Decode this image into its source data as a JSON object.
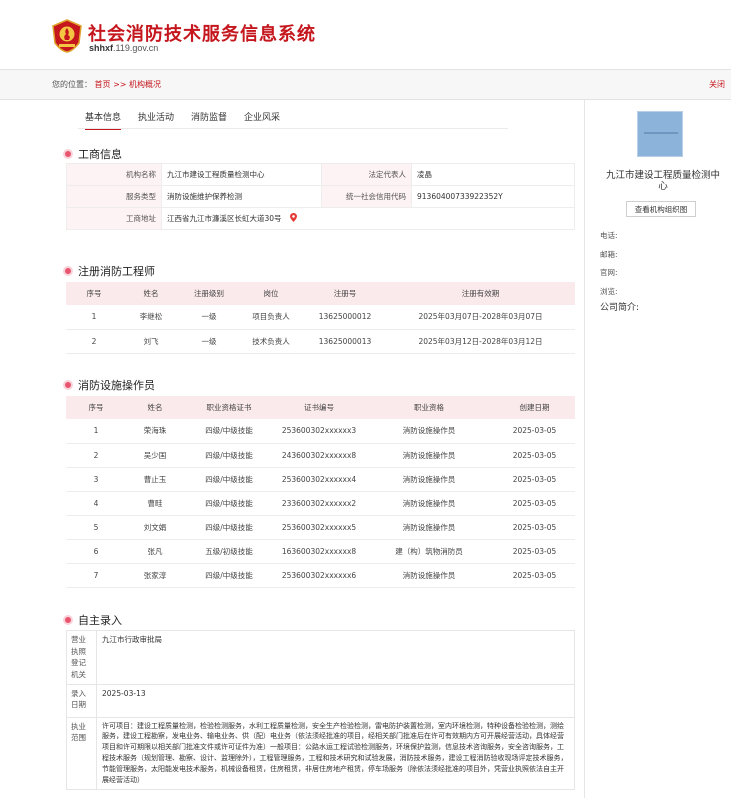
{
  "site": {
    "title": "社会消防技术服务信息系统",
    "url_prefix": "shhxf",
    "url_suffix": ".119.gov.cn"
  },
  "breadcrumb": {
    "prefix": "您的位置：",
    "home": "首页",
    "sep": ">>",
    "current": "机构概况",
    "close": "关闭"
  },
  "tabs": [
    {
      "label": "基本信息",
      "active": true
    },
    {
      "label": "执业活动",
      "active": false
    },
    {
      "label": "消防监督",
      "active": false
    },
    {
      "label": "企业风采",
      "active": false
    }
  ],
  "business": {
    "title": "工商信息",
    "name_label": "机构名称",
    "name": "九江市建设工程质量检测中心",
    "rep_label": "法定代表人",
    "rep": "凌晶",
    "service_label": "服务类型",
    "service": "消防设施维护保养检测",
    "credit_label": "统一社会信用代码",
    "credit": "91360400733922352Y",
    "address_label": "工商地址",
    "address": "江西省九江市濂溪区长虹大道30号"
  },
  "engineers": {
    "title": "注册消防工程师",
    "headers": [
      "序号",
      "姓名",
      "注册级别",
      "岗位",
      "注册号",
      "注册有效期"
    ],
    "rows": [
      [
        "1",
        "李继松",
        "一级",
        "项目负责人",
        "13625000012",
        "2025年03月07日-2028年03月07日"
      ],
      [
        "2",
        "刘飞",
        "一级",
        "技术负责人",
        "13625000013",
        "2025年03月12日-2028年03月12日"
      ]
    ]
  },
  "operators": {
    "title": "消防设施操作员",
    "headers": [
      "序号",
      "姓名",
      "职业资格证书",
      "证书编号",
      "职业资格",
      "创建日期"
    ],
    "rows": [
      [
        "1",
        "荣海珠",
        "四级/中级技能",
        "253600302xxxxxx3",
        "消防设施操作员",
        "2025-03-05"
      ],
      [
        "2",
        "吴少国",
        "四级/中级技能",
        "243600302xxxxxx8",
        "消防设施操作员",
        "2025-03-05"
      ],
      [
        "3",
        "曹止玉",
        "四级/中级技能",
        "253600302xxxxxx4",
        "消防设施操作员",
        "2025-03-05"
      ],
      [
        "4",
        "曹畦",
        "四级/中级技能",
        "233600302xxxxxx2",
        "消防设施操作员",
        "2025-03-05"
      ],
      [
        "5",
        "刘文娟",
        "四级/中级技能",
        "253600302xxxxxx5",
        "消防设施操作员",
        "2025-03-05"
      ],
      [
        "6",
        "张凡",
        "五级/初级技能",
        "163600302xxxxxx8",
        "建（构）筑物消防员",
        "2025-03-05"
      ],
      [
        "7",
        "张家淳",
        "四级/中级技能",
        "253600302xxxxxx6",
        "消防设施操作员",
        "2025-03-05"
      ]
    ]
  },
  "self_entry": {
    "title": "自主录入",
    "authority_label": "营业执照登记机关",
    "authority": "九江市行政审批局",
    "date_label": "录入日期",
    "date": "2025-03-13",
    "scope_label": "执业范围",
    "scope": "许可项目：建设工程质量检测，检验检测服务，水利工程质量检测，安全生产检验检测，雷电防护装置检测，室内环境检测，特种设备检验检测，测绘服务，建设工程勘察，发电业务、输电业务、供（配）电业务（依法须经批准的项目，经相关部门批准后在许可有效期内方可开展经营活动，具体经营项目和许可期限以相关部门批准文件或许可证件为准）一般项目：公路水运工程试验检测服务，环境保护监测，信息技术咨询服务，安全咨询服务，工程技术服务（规划管理、勘察、设计、监理除外），工程管理服务，工程和技术研究和试验发展，消防技术服务，建设工程消防验收现场评定技术服务，节能管理服务，太阳能发电技术服务，机械设备租赁，住房租赁，非居住房地产租赁，停车场服务（除依法须经批准的项目外，凭营业执照依法自主开展经营活动）"
  },
  "sidebar": {
    "org_name": "九江市建设工程质量检测中心",
    "chart_button": "查看机构组织图",
    "fields": [
      "电话:",
      "邮箱:",
      "官网:",
      "浏览:"
    ],
    "intro": "公司简介:"
  },
  "colors": {
    "brand": "#c5161d",
    "header_bg": "#fbeaec",
    "dot": "#e8556e"
  }
}
